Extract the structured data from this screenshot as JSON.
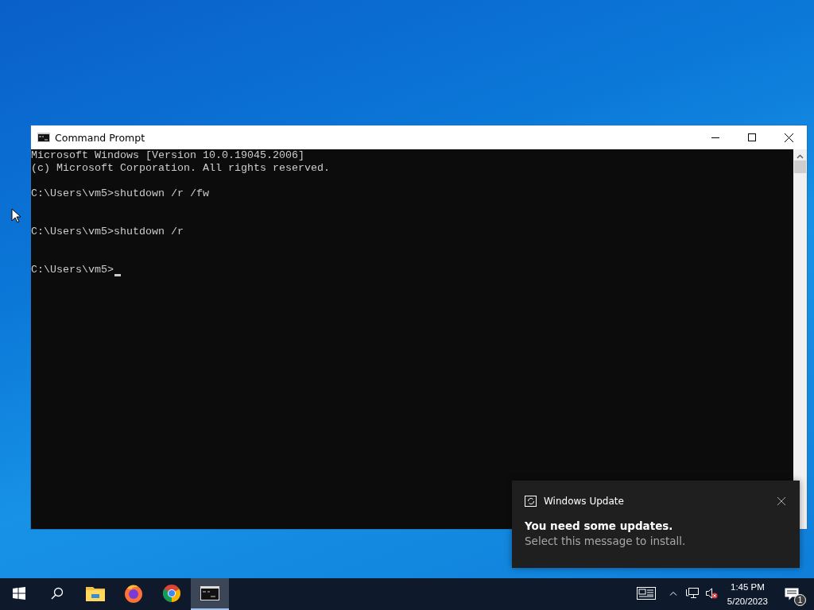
{
  "window": {
    "title": "Command Prompt",
    "focused": true
  },
  "console": {
    "header": [
      "Microsoft Windows [Version 10.0.19045.2006]",
      "(c) Microsoft Corporation. All rights reserved."
    ],
    "entries": [
      {
        "prompt": "C:\\Users\\vm5>",
        "command": "shutdown /r /fw",
        "cursor": false
      },
      {
        "prompt": "C:\\Users\\vm5>",
        "command": "shutdown /r",
        "cursor": false
      },
      {
        "prompt": "C:\\Users\\vm5>",
        "cursor": true
      }
    ]
  },
  "toast": {
    "app": "Windows Update",
    "title": "You need some updates.",
    "message": "Select this message to install."
  },
  "taskbar": {
    "apps": [
      {
        "kind": "files",
        "selected": false
      },
      {
        "kind": "firefox",
        "selected": false
      },
      {
        "kind": "chrome",
        "selected": false
      },
      {
        "kind": "terminal",
        "selected": true
      }
    ],
    "clock": {
      "time": "1:45 PM",
      "date": "5/20/2023"
    },
    "notification_count": "1",
    "volume_muted": true
  }
}
